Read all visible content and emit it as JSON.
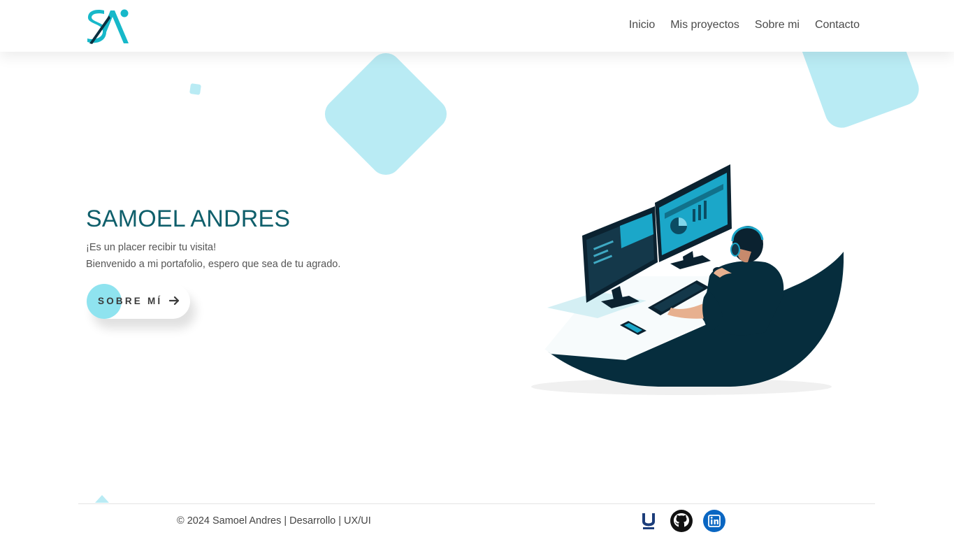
{
  "brand": {
    "logo_alt": "SA logo",
    "accent": "#17b8c9",
    "dark": "#0b2f3f",
    "light_accent": "#b9ebf4"
  },
  "nav": {
    "items": [
      {
        "label": "Inicio"
      },
      {
        "label": "Mis proyectos"
      },
      {
        "label": "Sobre mi"
      },
      {
        "label": "Contacto"
      }
    ]
  },
  "hero": {
    "title": "SAMOEL ANDRES",
    "line1": "¡Es un placer recibir tu visita!",
    "line2": "Bienvenido a mi portafolio, espero que sea de tu agrado.",
    "cta_label": "SOBRE MÍ",
    "cta_icon": "arrow-right-icon",
    "illustration": "developer-at-desk-illustration"
  },
  "footer": {
    "text": "© 2024 Samoel Andres | Desarrollo | UX/UI",
    "social": [
      {
        "name": "udemy-icon"
      },
      {
        "name": "github-icon"
      },
      {
        "name": "linkedin-icon",
        "color": "#0a66c2"
      }
    ]
  }
}
